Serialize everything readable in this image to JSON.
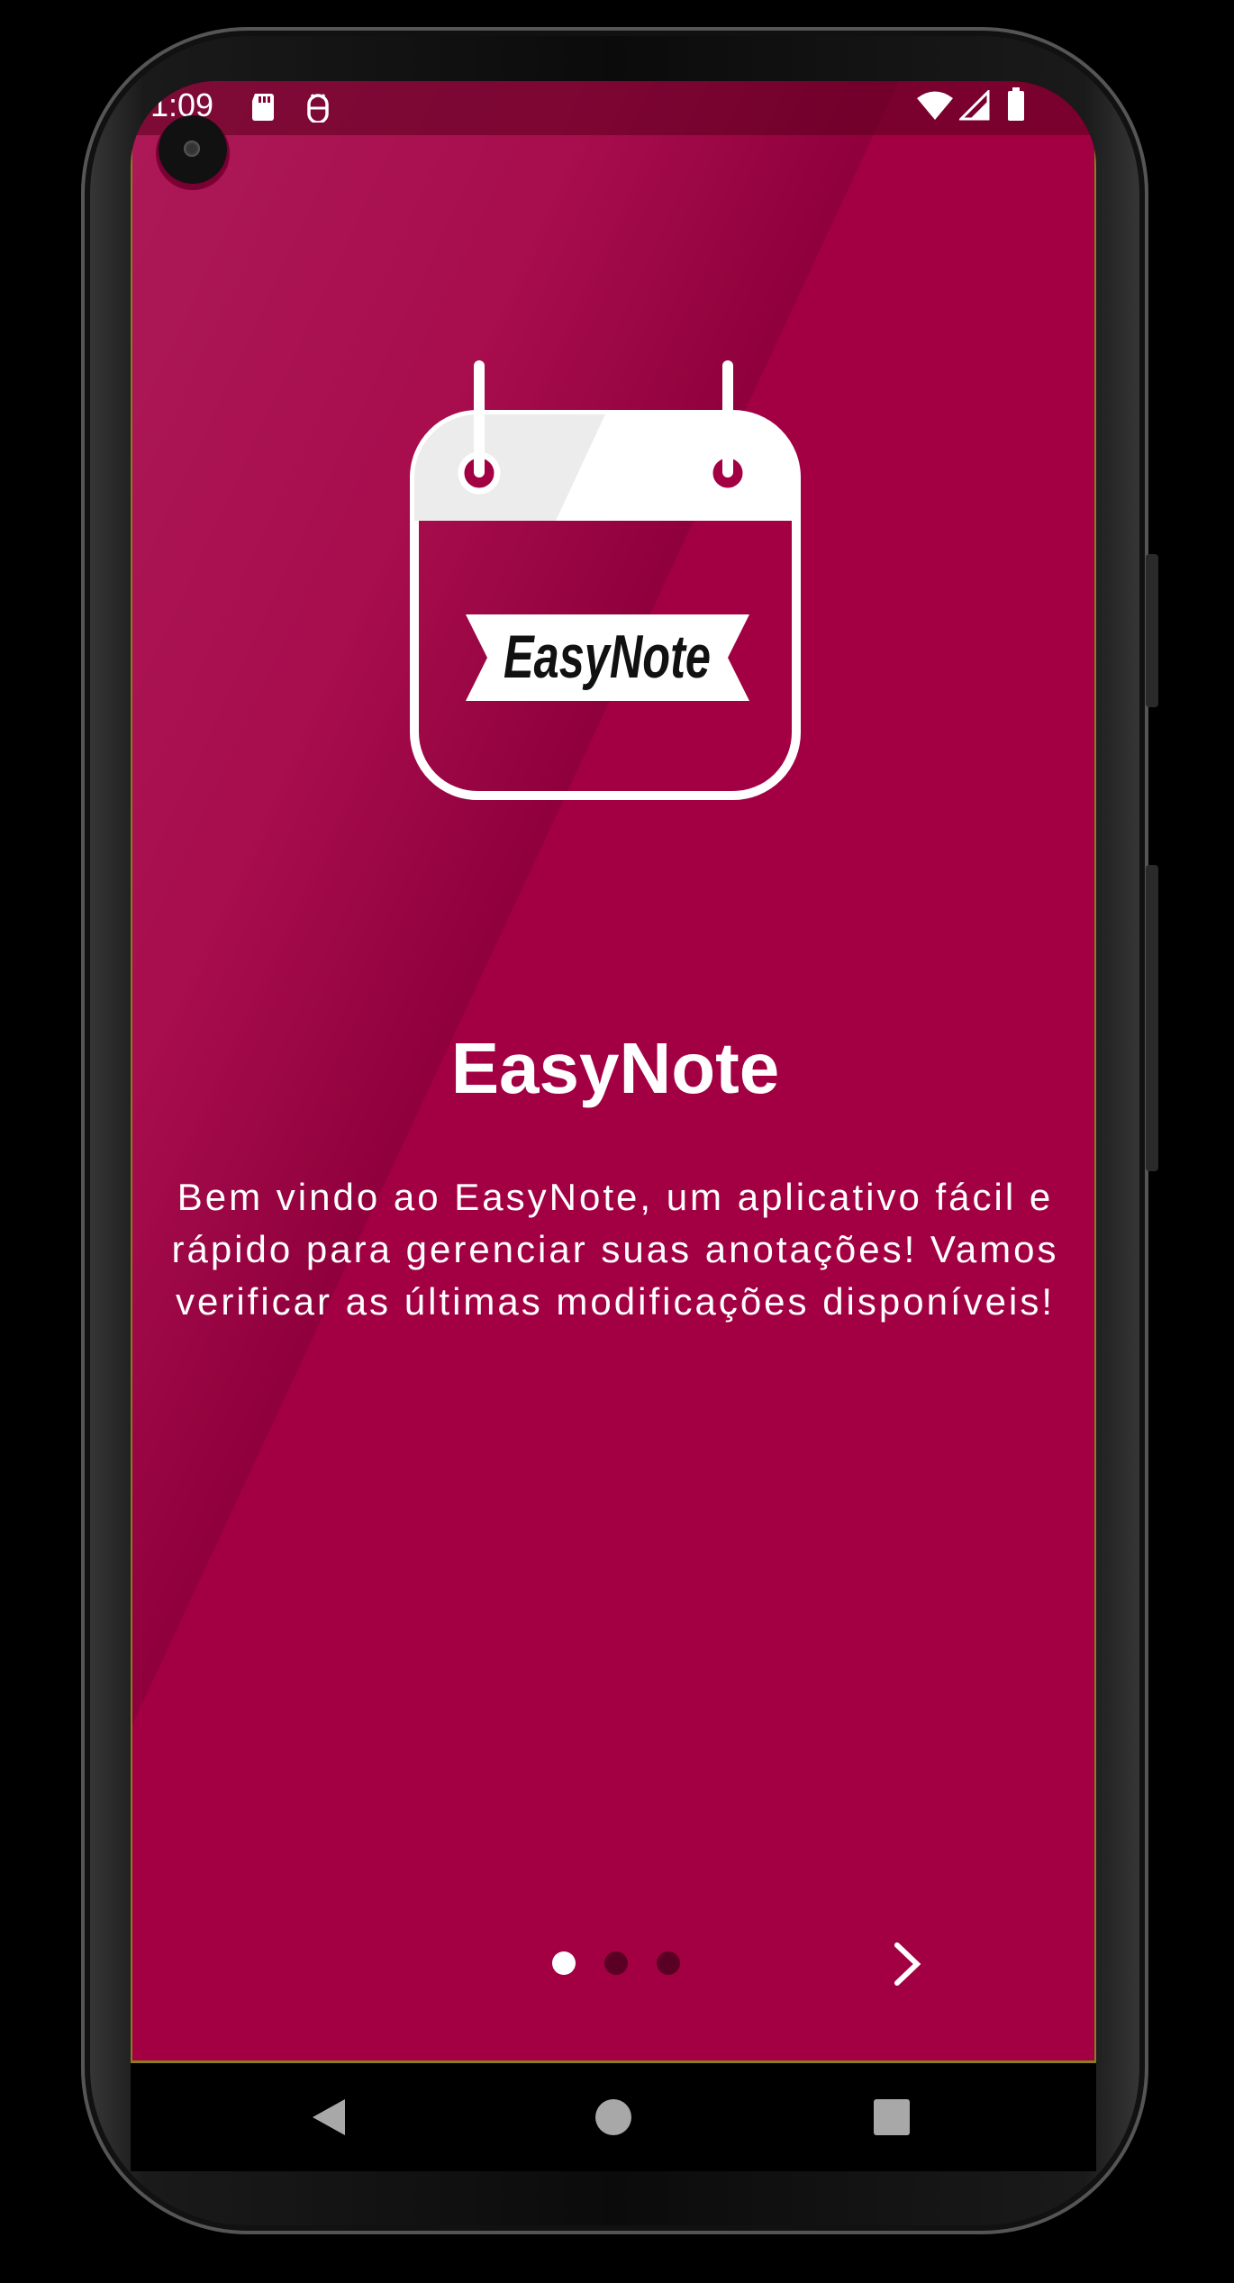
{
  "status_bar": {
    "time": "1:09",
    "icons": [
      "sd-card-icon",
      "android-debug-icon",
      "wifi-icon",
      "cell-signal-icon",
      "battery-icon"
    ]
  },
  "logo": {
    "text": "EasyNote"
  },
  "onboarding": {
    "title": "EasyNote",
    "description": "Bem vindo ao EasyNote, um aplicativo fácil e rápido para gerenciar suas anotações! Vamos verificar as últimas modificações disponíveis!",
    "page_count": 3,
    "active_page": 1
  },
  "navigation": {
    "next_icon": "chevron-right-icon",
    "buttons": [
      "back-icon",
      "home-icon",
      "recents-icon"
    ]
  },
  "colors": {
    "background": "#a30044",
    "accent": "#ffffff",
    "inactive_dot": "#5a0024"
  }
}
